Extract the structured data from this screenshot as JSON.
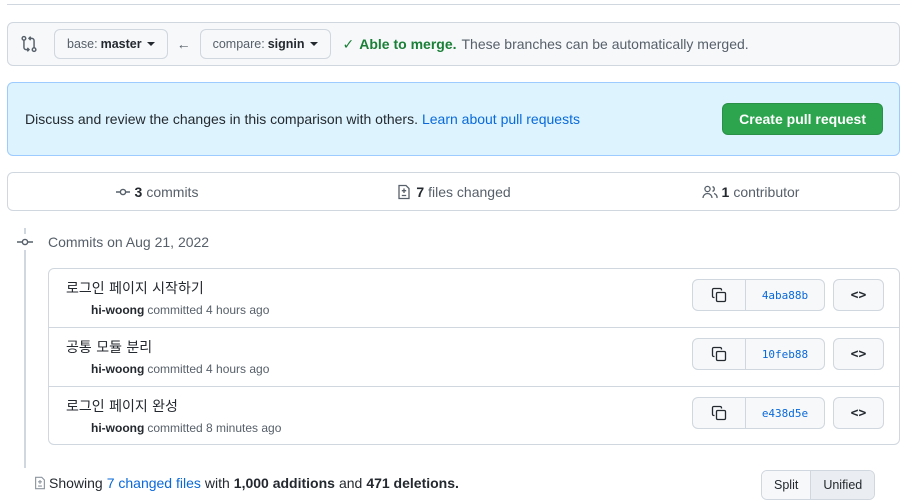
{
  "compare": {
    "base_prefix": "base:",
    "base_value": "master",
    "compare_prefix": "compare:",
    "compare_value": "signin",
    "merge_ok": "Able to merge.",
    "merge_text": "These branches can be automatically merged."
  },
  "info": {
    "text": "Discuss and review the changes in this comparison with others.",
    "link": "Learn about pull requests",
    "button": "Create pull request"
  },
  "summary": {
    "commits_count": "3",
    "commits_label": "commits",
    "files_count": "7",
    "files_label": "files changed",
    "contributors_count": "1",
    "contributors_label": "contributor"
  },
  "timeline": {
    "heading": "Commits on Aug 21, 2022",
    "commits": [
      {
        "title": "로그인 페이지 시작하기",
        "author": "hi-woong",
        "meta": "committed 4 hours ago",
        "sha": "4aba88b"
      },
      {
        "title": "공통 모듈 분리",
        "author": "hi-woong",
        "meta": "committed 4 hours ago",
        "sha": "10feb88"
      },
      {
        "title": "로그인 페이지 완성",
        "author": "hi-woong",
        "meta": "committed 8 minutes ago",
        "sha": "e438d5e"
      }
    ]
  },
  "footer": {
    "showing": "Showing",
    "files_link": "7 changed files",
    "with": "with",
    "additions": "1,000 additions",
    "and": "and",
    "deletions": "471 deletions.",
    "split": "Split",
    "unified": "Unified"
  },
  "colors": {
    "accent": "#0969da",
    "success": "#1a7f37",
    "button_green": "#2da44e",
    "info_bg": "#ddf4ff"
  },
  "icons": {
    "swap": "git-compare-icon",
    "arrow": "arrow-left-icon",
    "check": "check-icon",
    "commit": "git-commit-icon",
    "diff": "file-diff-icon",
    "people": "people-icon",
    "copy": "copy-icon",
    "code": "code-icon"
  }
}
